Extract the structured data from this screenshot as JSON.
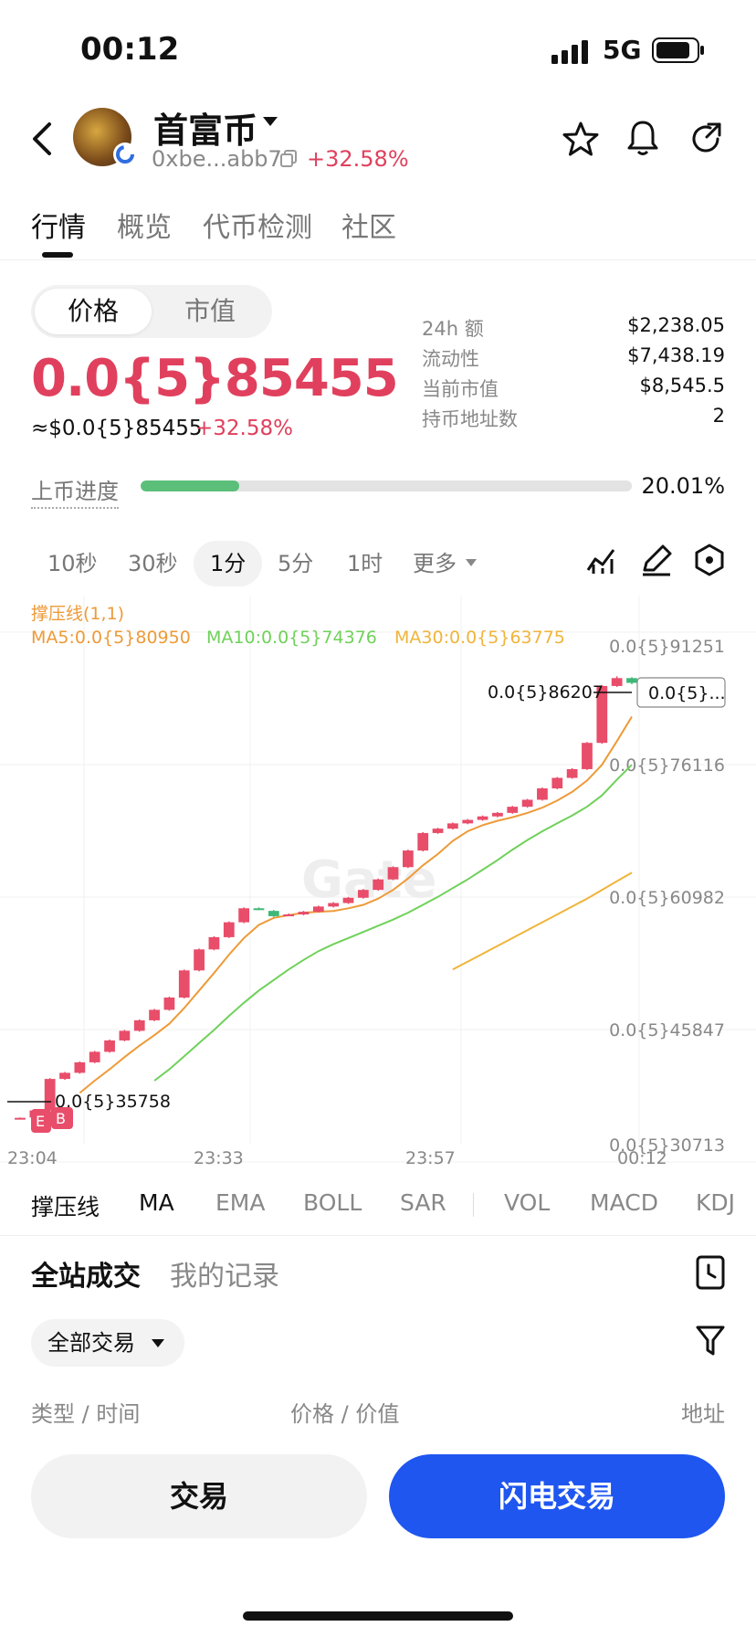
{
  "status_bar": {
    "time": "00:12",
    "network": "5G"
  },
  "header": {
    "coin_name": "首富币",
    "address": "0xbe...abb7",
    "change": "+32.58%"
  },
  "tabs": [
    "行情",
    "概览",
    "代币检测",
    "社区"
  ],
  "price_toggle": {
    "price": "价格",
    "market_cap": "市值"
  },
  "price": {
    "main": "0.0{5}85455",
    "usd": "≈$0.0{5}85455",
    "change": "+32.58%"
  },
  "stats": [
    {
      "label": "24h  额",
      "value": "$2,238.05"
    },
    {
      "label": "流动性",
      "value": "$7,438.19"
    },
    {
      "label": "当前市值",
      "value": "$8,545.5"
    },
    {
      "label": "持币地址数",
      "value": "2"
    }
  ],
  "listing_progress": {
    "label": "上币进度",
    "value": "20.01%",
    "fraction": 0.2001
  },
  "timeframes": [
    "10秒",
    "30秒",
    "1分",
    "5分",
    "1时",
    "更多"
  ],
  "active_timeframe": "1分",
  "chart_header": {
    "indicator_title": "撑压线(1,1)",
    "ma5": "MA5:0.0{5}80950",
    "ma10": "MA10:0.0{5}74376",
    "ma30": "MA30:0.0{5}63775",
    "high_label": "0.0{5}86207",
    "current_tag": "0.0{5}...",
    "low_label": "0.0{5}35758",
    "watermark": "Gate"
  },
  "chart_data": {
    "type": "candlestick",
    "y_axis_labels": [
      "0.0{5}91251",
      "0.0{5}76116",
      "0.0{5}60982",
      "0.0{5}45847",
      "0.0{5}30713"
    ],
    "x_axis_labels": [
      "23:04",
      "23:33",
      "23:57",
      "00:12"
    ],
    "ylim": [
      30713,
      91251
    ],
    "candles": [
      {
        "o": 35700,
        "c": 35758,
        "h": 35800,
        "l": 35600
      },
      {
        "o": 35800,
        "c": 36600,
        "h": 36700,
        "l": 35700
      },
      {
        "o": 36600,
        "c": 40200,
        "h": 40300,
        "l": 36500
      },
      {
        "o": 40200,
        "c": 40900,
        "h": 41000,
        "l": 40100
      },
      {
        "o": 40900,
        "c": 42100,
        "h": 42200,
        "l": 40800
      },
      {
        "o": 42100,
        "c": 43300,
        "h": 43400,
        "l": 42000
      },
      {
        "o": 43300,
        "c": 44600,
        "h": 44700,
        "l": 43200
      },
      {
        "o": 44600,
        "c": 45700,
        "h": 45800,
        "l": 44500
      },
      {
        "o": 45700,
        "c": 46900,
        "h": 47000,
        "l": 45600
      },
      {
        "o": 46900,
        "c": 48100,
        "h": 48200,
        "l": 46800
      },
      {
        "o": 48100,
        "c": 49500,
        "h": 49600,
        "l": 48000
      },
      {
        "o": 49500,
        "c": 52600,
        "h": 52700,
        "l": 49400
      },
      {
        "o": 52600,
        "c": 55000,
        "h": 55100,
        "l": 52500
      },
      {
        "o": 55000,
        "c": 56400,
        "h": 56500,
        "l": 54900
      },
      {
        "o": 56400,
        "c": 58100,
        "h": 58200,
        "l": 56300
      },
      {
        "o": 58100,
        "c": 59700,
        "h": 59800,
        "l": 58000
      },
      {
        "o": 59700,
        "c": 59600,
        "h": 59800,
        "l": 59500
      },
      {
        "o": 59400,
        "c": 58800,
        "h": 59500,
        "l": 58700
      },
      {
        "o": 58900,
        "c": 59000,
        "h": 59100,
        "l": 58800
      },
      {
        "o": 59000,
        "c": 59300,
        "h": 59400,
        "l": 58900
      },
      {
        "o": 59300,
        "c": 59900,
        "h": 60000,
        "l": 59200
      },
      {
        "o": 59900,
        "c": 60300,
        "h": 60400,
        "l": 59800
      },
      {
        "o": 60300,
        "c": 60900,
        "h": 61000,
        "l": 60200
      },
      {
        "o": 60900,
        "c": 61800,
        "h": 61900,
        "l": 60800
      },
      {
        "o": 61800,
        "c": 63000,
        "h": 63100,
        "l": 61700
      },
      {
        "o": 63000,
        "c": 64400,
        "h": 64500,
        "l": 62900
      },
      {
        "o": 64400,
        "c": 66300,
        "h": 66400,
        "l": 64300
      },
      {
        "o": 66300,
        "c": 68300,
        "h": 68400,
        "l": 66200
      },
      {
        "o": 68300,
        "c": 68800,
        "h": 68900,
        "l": 68200
      },
      {
        "o": 68800,
        "c": 69400,
        "h": 69500,
        "l": 68700
      },
      {
        "o": 69400,
        "c": 69800,
        "h": 69900,
        "l": 69300
      },
      {
        "o": 69800,
        "c": 70200,
        "h": 70300,
        "l": 69700
      },
      {
        "o": 70200,
        "c": 70600,
        "h": 70700,
        "l": 70100
      },
      {
        "o": 70600,
        "c": 71300,
        "h": 71400,
        "l": 70500
      },
      {
        "o": 71300,
        "c": 72100,
        "h": 72200,
        "l": 71200
      },
      {
        "o": 72100,
        "c": 73400,
        "h": 73500,
        "l": 72000
      },
      {
        "o": 73400,
        "c": 74600,
        "h": 74700,
        "l": 73300
      },
      {
        "o": 74600,
        "c": 75600,
        "h": 75700,
        "l": 74500
      },
      {
        "o": 75600,
        "c": 78600,
        "h": 78700,
        "l": 75500
      },
      {
        "o": 78600,
        "c": 85100,
        "h": 85200,
        "l": 78500
      },
      {
        "o": 85100,
        "c": 86000,
        "h": 86207,
        "l": 85000
      },
      {
        "o": 86000,
        "c": 85455,
        "h": 86100,
        "l": 85300
      }
    ],
    "ma5": [
      null,
      null,
      null,
      null,
      38600,
      40000,
      41300,
      42700,
      44000,
      45200,
      46500,
      48300,
      50300,
      52300,
      54400,
      56300,
      57800,
      58600,
      58900,
      59200,
      59300,
      59400,
      59700,
      60100,
      60800,
      61800,
      63100,
      64600,
      65900,
      67400,
      68500,
      69200,
      69700,
      70100,
      70600,
      71200,
      72000,
      73000,
      74300,
      76100,
      78800,
      81600
    ],
    "ma10": [
      null,
      null,
      null,
      null,
      null,
      null,
      null,
      null,
      null,
      40000,
      41300,
      42800,
      44300,
      45800,
      47400,
      48900,
      50300,
      51500,
      52700,
      53800,
      54800,
      55600,
      56300,
      57000,
      57700,
      58400,
      59200,
      60100,
      61000,
      62000,
      63000,
      64100,
      65200,
      66400,
      67500,
      68500,
      69400,
      70300,
      71300,
      72600,
      74400,
      76100
    ],
    "ma30": [
      null,
      null,
      null,
      null,
      null,
      null,
      null,
      null,
      null,
      null,
      null,
      null,
      null,
      null,
      null,
      null,
      null,
      null,
      null,
      null,
      null,
      null,
      null,
      null,
      null,
      null,
      null,
      null,
      null,
      52700,
      53600,
      54500,
      55400,
      56300,
      57200,
      58100,
      59000,
      59900,
      60800,
      61800,
      62800,
      63775
    ],
    "series_names": [
      "MA5",
      "MA10",
      "MA30"
    ],
    "colors": {
      "up": "#e84d6a",
      "down": "#3fb877",
      "ma5": "#ee9a38",
      "ma10": "#6fd15a",
      "ma30": "#f0b43a"
    }
  },
  "chart_markers": {
    "e": "E",
    "b": "B"
  },
  "indicators": [
    "撑压线",
    "MA",
    "EMA",
    "BOLL",
    "SAR",
    "VOL",
    "MACD",
    "KDJ"
  ],
  "trade_tabs": [
    "全站成交",
    "我的记录"
  ],
  "filter": "全部交易",
  "table_cols": {
    "type_time": "类型 / 时间",
    "price_value": "价格 / 价值",
    "address": "地址"
  },
  "buttons": {
    "trade": "交易",
    "flash": "闪电交易"
  }
}
